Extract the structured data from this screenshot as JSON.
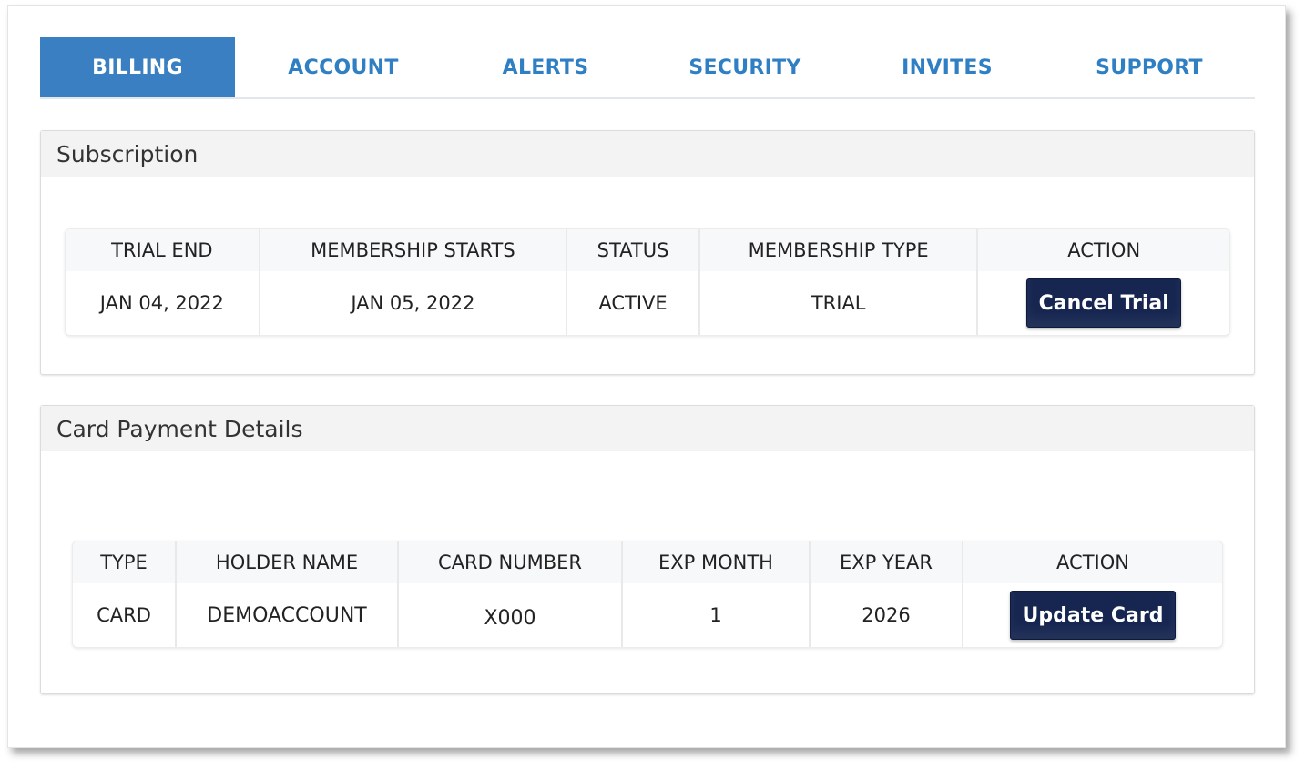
{
  "tabs": [
    {
      "label": "BILLING",
      "active": true
    },
    {
      "label": "ACCOUNT",
      "active": false
    },
    {
      "label": "ALERTS",
      "active": false
    },
    {
      "label": "SECURITY",
      "active": false
    },
    {
      "label": "INVITES",
      "active": false
    },
    {
      "label": "SUPPORT",
      "active": false
    }
  ],
  "subscription": {
    "title": "Subscription",
    "headers": [
      "TRIAL END",
      "MEMBERSHIP STARTS",
      "STATUS",
      "MEMBERSHIP TYPE",
      "ACTION"
    ],
    "row": {
      "trial_end": "JAN 04, 2022",
      "membership_starts": "JAN 05, 2022",
      "status": "ACTIVE",
      "membership_type": "TRIAL"
    },
    "action_label": "Cancel Trial"
  },
  "card": {
    "title": "Card Payment Details",
    "headers": [
      "TYPE",
      "HOLDER NAME",
      "CARD NUMBER",
      "EXP MONTH",
      "EXP YEAR",
      "ACTION"
    ],
    "row": {
      "type": "CARD",
      "holder_name": "DEMOACCOUNT",
      "card_number": "X000",
      "exp_month": "1",
      "exp_year": "2026"
    },
    "action_label": "Update Card"
  },
  "colors": {
    "tab_active_bg": "#3a7fc1",
    "tab_text": "#2f7fc4",
    "button_bg": "#162650"
  }
}
